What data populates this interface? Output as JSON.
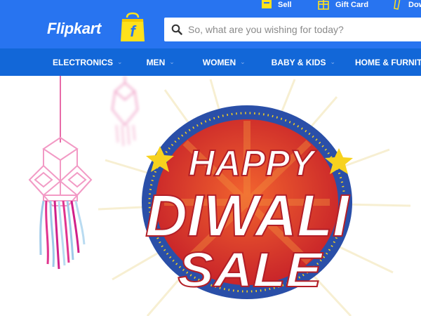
{
  "top_links": [
    {
      "label": "Sell",
      "icon": "sell-icon"
    },
    {
      "label": "Gift Card",
      "icon": "gift-icon"
    },
    {
      "label": "Down",
      "icon": "phone-icon"
    }
  ],
  "logo": {
    "text": "Flipkart",
    "bag_letter": "f"
  },
  "search": {
    "placeholder": "So, what are you wishing for today?"
  },
  "nav": [
    {
      "label": "ELECTRONICS",
      "chevron": "⌄"
    },
    {
      "label": "MEN",
      "chevron": "⌄"
    },
    {
      "label": "WOMEN",
      "chevron": "⌄"
    },
    {
      "label": "BABY & KIDS",
      "chevron": "⌄"
    },
    {
      "label": "HOME & FURNITU",
      "chevron": ""
    }
  ],
  "banner": {
    "line1": "HAPPY",
    "line2": "DIWALI",
    "line3": "SALE"
  },
  "colors": {
    "header": "#2874f0",
    "nav": "#1267d8",
    "logo_bag": "#ffe11b",
    "badge_blue": "#2a4fa8",
    "badge_red": "#d8322a",
    "star": "#f7d21e"
  }
}
